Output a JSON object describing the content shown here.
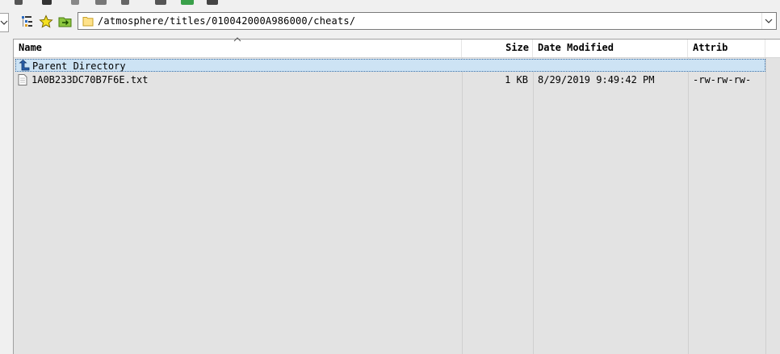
{
  "address_bar": {
    "path": "/atmosphere/titles/010042000A986000/cheats/"
  },
  "file_list": {
    "columns": {
      "name": "Name",
      "size": "Size",
      "date": "Date Modified",
      "attrib": "Attrib"
    },
    "sorted_by": "name",
    "rows": [
      {
        "name": "Parent Directory",
        "size": "",
        "date": "",
        "attrib": "",
        "icon": "parent-directory-icon",
        "selected": true
      },
      {
        "name": "1A0B233DC70B7F6E.txt",
        "size": "1 KB",
        "date": "8/29/2019 9:49:42 PM",
        "attrib": "-rw-rw-rw-",
        "icon": "text-file-icon",
        "selected": false
      }
    ]
  },
  "colors": {
    "list_background": "#e3e3e3",
    "selection": "#cde3f4",
    "selection_border": "#3a6ea5"
  }
}
